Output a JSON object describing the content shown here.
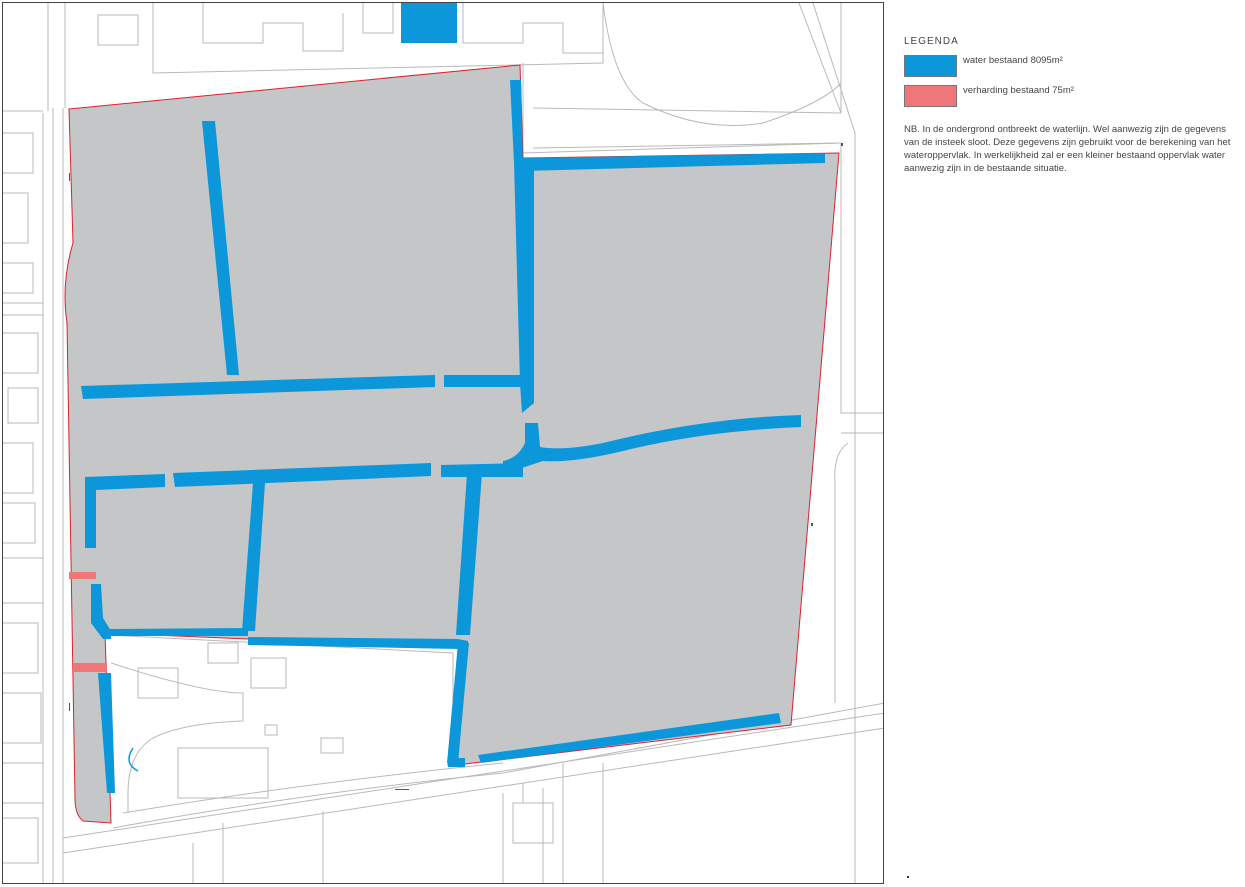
{
  "legend": {
    "title": "LEGENDA",
    "items": [
      {
        "label": "water bestaand 8095m²",
        "color": "#0b97da"
      },
      {
        "label": "verharding bestaand 75m²",
        "color": "#ef7778"
      }
    ],
    "note": "NB. In de ondergrond ontbreekt de waterlijn. Wel aanwezig zijn de gegevens van de insteek sloot. Deze gegevens zijn gebruikt voor de berekening van het wateroppervlak. In werkelijkheid zal er een kleiner bestaand oppervlak water aanwezig zijn in de bestaande situatie."
  },
  "map": {
    "colors": {
      "water": "#0b97da",
      "pavement": "#ef7778",
      "plot": "#c5c6c8",
      "boundary": "#d9232d",
      "lines": "#b9b9b9"
    }
  }
}
